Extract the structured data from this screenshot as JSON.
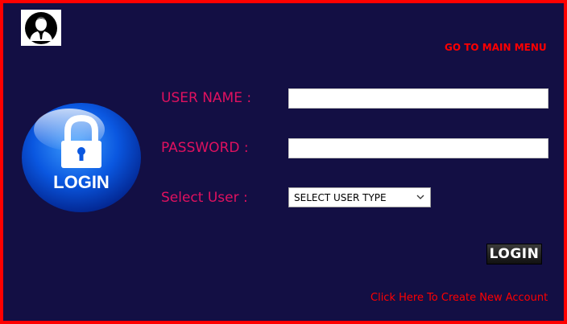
{
  "header": {
    "avatar_icon": "user-avatar-icon",
    "main_menu_link": "GO TO MAIN MENU"
  },
  "badge": {
    "icon": "padlock-icon",
    "text": "LOGIN"
  },
  "form": {
    "username_label": "USER NAME :",
    "username_value": "",
    "password_label": "PASSWORD :",
    "password_value": "",
    "user_type_label": "Select User :",
    "user_type_selected": "SELECT USER TYPE"
  },
  "actions": {
    "login_button": "LOGIN",
    "create_account_link": "Click Here To Create New Account"
  },
  "colors": {
    "background": "#130f44",
    "border": "#ff0000",
    "label": "#e0115f",
    "link": "#ff0000"
  }
}
